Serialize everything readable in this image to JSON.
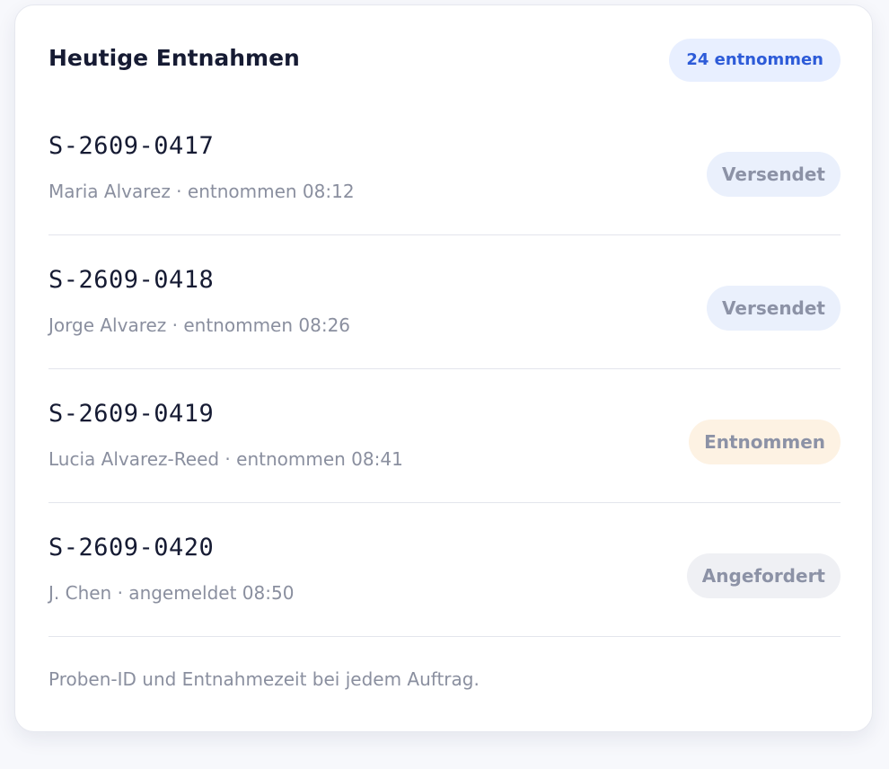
{
  "card": {
    "title": "Heutige Entnahmen",
    "count_badge": "24 entnommen"
  },
  "samples": [
    {
      "id": "S-2609-0417",
      "meta": "Maria Alvarez · entnommen 08:12",
      "status": "Versendet"
    },
    {
      "id": "S-2609-0418",
      "meta": "Jorge Alvarez · entnommen 08:26",
      "status": "Versendet"
    },
    {
      "id": "S-2609-0419",
      "meta": "Lucia Alvarez-Reed · entnommen 08:41",
      "status": "Entnommen"
    },
    {
      "id": "S-2609-0420",
      "meta": "J. Chen · angemeldet 08:50",
      "status": "Angefordert"
    }
  ],
  "footer": {
    "note": "Proben-ID und Entnahmezeit bei jedem Auftrag."
  },
  "colors": {
    "accent": "#2d5bd8",
    "badge_bg": "#e8efff",
    "status_versendet_bg": "#eaf0fc",
    "status_entnommen_bg": "#fdf2e3",
    "status_angefordert_bg": "#eff0f4"
  }
}
